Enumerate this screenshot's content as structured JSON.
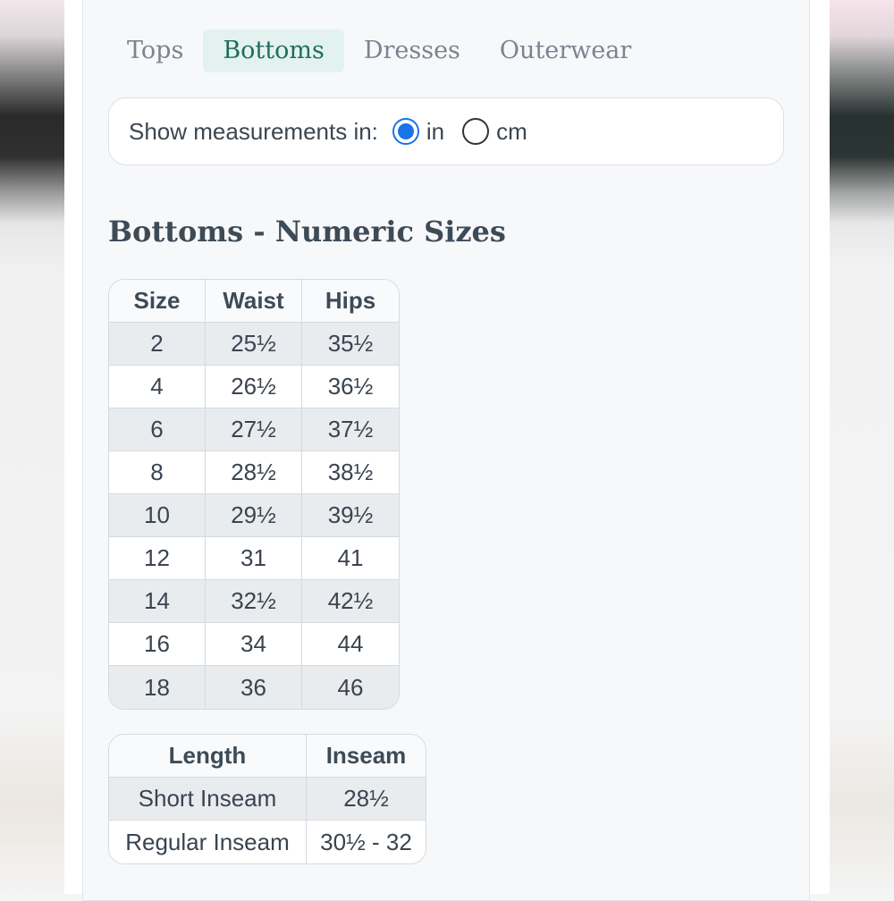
{
  "tabs": [
    {
      "label": "Tops",
      "active": false
    },
    {
      "label": "Bottoms",
      "active": true
    },
    {
      "label": "Dresses",
      "active": false
    },
    {
      "label": "Outerwear",
      "active": false
    }
  ],
  "units": {
    "label": "Show measurements in:",
    "options": [
      {
        "label": "in",
        "checked": true
      },
      {
        "label": "cm",
        "checked": false
      }
    ]
  },
  "section": {
    "title": "Bottoms - Numeric Sizes"
  },
  "size_table": {
    "headers": [
      "Size",
      "Waist",
      "Hips"
    ],
    "rows": [
      [
        "2",
        "25½",
        "35½"
      ],
      [
        "4",
        "26½",
        "36½"
      ],
      [
        "6",
        "27½",
        "37½"
      ],
      [
        "8",
        "28½",
        "38½"
      ],
      [
        "10",
        "29½",
        "39½"
      ],
      [
        "12",
        "31",
        "41"
      ],
      [
        "14",
        "32½",
        "42½"
      ],
      [
        "16",
        "34",
        "44"
      ],
      [
        "18",
        "36",
        "46"
      ]
    ]
  },
  "inseam_table": {
    "headers": [
      "Length",
      "Inseam"
    ],
    "rows": [
      [
        "Short Inseam",
        "28½"
      ],
      [
        "Regular Inseam",
        "30½ - 32"
      ]
    ]
  },
  "colors": {
    "accent": "#1a73e8",
    "active_tab_bg": "#e3f2ef",
    "active_tab_text": "#1f6d5e"
  }
}
